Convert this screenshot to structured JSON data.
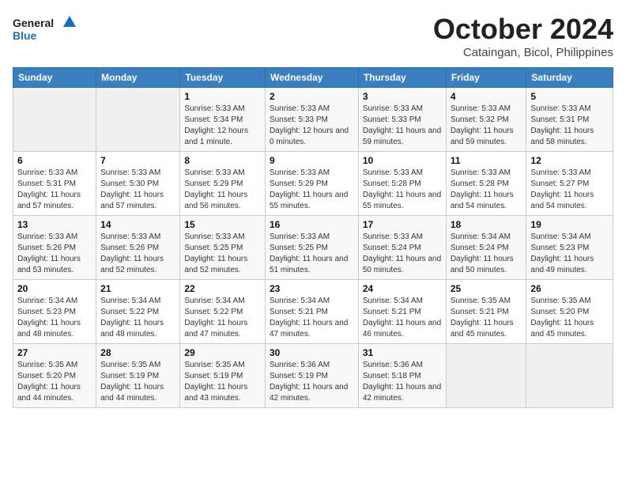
{
  "logo": {
    "line1": "General",
    "line2": "Blue"
  },
  "title": "October 2024",
  "subtitle": "Cataingan, Bicol, Philippines",
  "weekdays": [
    "Sunday",
    "Monday",
    "Tuesday",
    "Wednesday",
    "Thursday",
    "Friday",
    "Saturday"
  ],
  "weeks": [
    [
      {
        "day": "",
        "sunrise": "",
        "sunset": "",
        "daylight": ""
      },
      {
        "day": "",
        "sunrise": "",
        "sunset": "",
        "daylight": ""
      },
      {
        "day": "1",
        "sunrise": "Sunrise: 5:33 AM",
        "sunset": "Sunset: 5:34 PM",
        "daylight": "Daylight: 12 hours and 1 minute."
      },
      {
        "day": "2",
        "sunrise": "Sunrise: 5:33 AM",
        "sunset": "Sunset: 5:33 PM",
        "daylight": "Daylight: 12 hours and 0 minutes."
      },
      {
        "day": "3",
        "sunrise": "Sunrise: 5:33 AM",
        "sunset": "Sunset: 5:33 PM",
        "daylight": "Daylight: 11 hours and 59 minutes."
      },
      {
        "day": "4",
        "sunrise": "Sunrise: 5:33 AM",
        "sunset": "Sunset: 5:32 PM",
        "daylight": "Daylight: 11 hours and 59 minutes."
      },
      {
        "day": "5",
        "sunrise": "Sunrise: 5:33 AM",
        "sunset": "Sunset: 5:31 PM",
        "daylight": "Daylight: 11 hours and 58 minutes."
      }
    ],
    [
      {
        "day": "6",
        "sunrise": "Sunrise: 5:33 AM",
        "sunset": "Sunset: 5:31 PM",
        "daylight": "Daylight: 11 hours and 57 minutes."
      },
      {
        "day": "7",
        "sunrise": "Sunrise: 5:33 AM",
        "sunset": "Sunset: 5:30 PM",
        "daylight": "Daylight: 11 hours and 57 minutes."
      },
      {
        "day": "8",
        "sunrise": "Sunrise: 5:33 AM",
        "sunset": "Sunset: 5:29 PM",
        "daylight": "Daylight: 11 hours and 56 minutes."
      },
      {
        "day": "9",
        "sunrise": "Sunrise: 5:33 AM",
        "sunset": "Sunset: 5:29 PM",
        "daylight": "Daylight: 11 hours and 55 minutes."
      },
      {
        "day": "10",
        "sunrise": "Sunrise: 5:33 AM",
        "sunset": "Sunset: 5:28 PM",
        "daylight": "Daylight: 11 hours and 55 minutes."
      },
      {
        "day": "11",
        "sunrise": "Sunrise: 5:33 AM",
        "sunset": "Sunset: 5:28 PM",
        "daylight": "Daylight: 11 hours and 54 minutes."
      },
      {
        "day": "12",
        "sunrise": "Sunrise: 5:33 AM",
        "sunset": "Sunset: 5:27 PM",
        "daylight": "Daylight: 11 hours and 54 minutes."
      }
    ],
    [
      {
        "day": "13",
        "sunrise": "Sunrise: 5:33 AM",
        "sunset": "Sunset: 5:26 PM",
        "daylight": "Daylight: 11 hours and 53 minutes."
      },
      {
        "day": "14",
        "sunrise": "Sunrise: 5:33 AM",
        "sunset": "Sunset: 5:26 PM",
        "daylight": "Daylight: 11 hours and 52 minutes."
      },
      {
        "day": "15",
        "sunrise": "Sunrise: 5:33 AM",
        "sunset": "Sunset: 5:25 PM",
        "daylight": "Daylight: 11 hours and 52 minutes."
      },
      {
        "day": "16",
        "sunrise": "Sunrise: 5:33 AM",
        "sunset": "Sunset: 5:25 PM",
        "daylight": "Daylight: 11 hours and 51 minutes."
      },
      {
        "day": "17",
        "sunrise": "Sunrise: 5:33 AM",
        "sunset": "Sunset: 5:24 PM",
        "daylight": "Daylight: 11 hours and 50 minutes."
      },
      {
        "day": "18",
        "sunrise": "Sunrise: 5:34 AM",
        "sunset": "Sunset: 5:24 PM",
        "daylight": "Daylight: 11 hours and 50 minutes."
      },
      {
        "day": "19",
        "sunrise": "Sunrise: 5:34 AM",
        "sunset": "Sunset: 5:23 PM",
        "daylight": "Daylight: 11 hours and 49 minutes."
      }
    ],
    [
      {
        "day": "20",
        "sunrise": "Sunrise: 5:34 AM",
        "sunset": "Sunset: 5:23 PM",
        "daylight": "Daylight: 11 hours and 48 minutes."
      },
      {
        "day": "21",
        "sunrise": "Sunrise: 5:34 AM",
        "sunset": "Sunset: 5:22 PM",
        "daylight": "Daylight: 11 hours and 48 minutes."
      },
      {
        "day": "22",
        "sunrise": "Sunrise: 5:34 AM",
        "sunset": "Sunset: 5:22 PM",
        "daylight": "Daylight: 11 hours and 47 minutes."
      },
      {
        "day": "23",
        "sunrise": "Sunrise: 5:34 AM",
        "sunset": "Sunset: 5:21 PM",
        "daylight": "Daylight: 11 hours and 47 minutes."
      },
      {
        "day": "24",
        "sunrise": "Sunrise: 5:34 AM",
        "sunset": "Sunset: 5:21 PM",
        "daylight": "Daylight: 11 hours and 46 minutes."
      },
      {
        "day": "25",
        "sunrise": "Sunrise: 5:35 AM",
        "sunset": "Sunset: 5:21 PM",
        "daylight": "Daylight: 11 hours and 45 minutes."
      },
      {
        "day": "26",
        "sunrise": "Sunrise: 5:35 AM",
        "sunset": "Sunset: 5:20 PM",
        "daylight": "Daylight: 11 hours and 45 minutes."
      }
    ],
    [
      {
        "day": "27",
        "sunrise": "Sunrise: 5:35 AM",
        "sunset": "Sunset: 5:20 PM",
        "daylight": "Daylight: 11 hours and 44 minutes."
      },
      {
        "day": "28",
        "sunrise": "Sunrise: 5:35 AM",
        "sunset": "Sunset: 5:19 PM",
        "daylight": "Daylight: 11 hours and 44 minutes."
      },
      {
        "day": "29",
        "sunrise": "Sunrise: 5:35 AM",
        "sunset": "Sunset: 5:19 PM",
        "daylight": "Daylight: 11 hours and 43 minutes."
      },
      {
        "day": "30",
        "sunrise": "Sunrise: 5:36 AM",
        "sunset": "Sunset: 5:19 PM",
        "daylight": "Daylight: 11 hours and 42 minutes."
      },
      {
        "day": "31",
        "sunrise": "Sunrise: 5:36 AM",
        "sunset": "Sunset: 5:18 PM",
        "daylight": "Daylight: 11 hours and 42 minutes."
      },
      {
        "day": "",
        "sunrise": "",
        "sunset": "",
        "daylight": ""
      },
      {
        "day": "",
        "sunrise": "",
        "sunset": "",
        "daylight": ""
      }
    ]
  ]
}
